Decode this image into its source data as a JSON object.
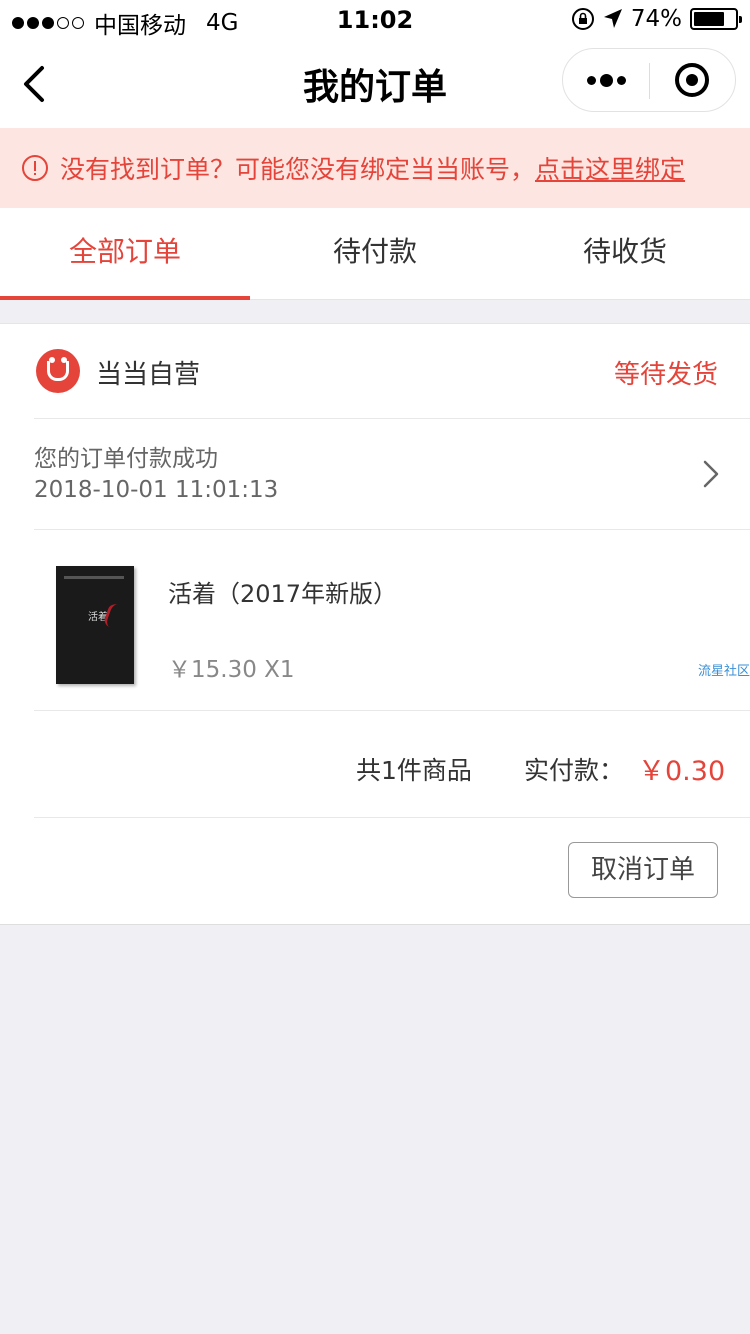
{
  "status_bar": {
    "carrier": "中国移动",
    "network": "4G",
    "time": "11:02",
    "battery": "74%",
    "battery_level": 0.74,
    "icons": [
      "signal-dots-icon",
      "orientation-lock-icon",
      "location-arrow-icon",
      "battery-icon"
    ]
  },
  "navbar": {
    "title": "我的订单",
    "icons": [
      "back-chevron-icon",
      "more-icon",
      "close-circle-icon"
    ]
  },
  "notice": {
    "text": "没有找到订单？可能您没有绑定当当账号，",
    "link": "点击这里绑定",
    "icon": "alert-circle-icon"
  },
  "tabs": [
    {
      "label": "全部订单",
      "active": true
    },
    {
      "label": "待付款",
      "active": false
    },
    {
      "label": "待收货",
      "active": false
    }
  ],
  "order": {
    "shop_name": "当当自营",
    "shop_status": "等待发货",
    "status_text": "您的订单付款成功",
    "status_time": "2018-10-01 11:01:13",
    "item": {
      "name": "活着（2017年新版）",
      "price": "￥15.30 X1",
      "cover_text": "活着"
    },
    "watermark": "流星社区",
    "total_count": "共1件商品",
    "total_label": "实付款：",
    "total_amount": "￥0.30",
    "cancel_label": "取消订单"
  },
  "colors": {
    "accent": "#e4443a",
    "notice_bg": "#fde6e1",
    "page_bg": "#efeff4"
  }
}
